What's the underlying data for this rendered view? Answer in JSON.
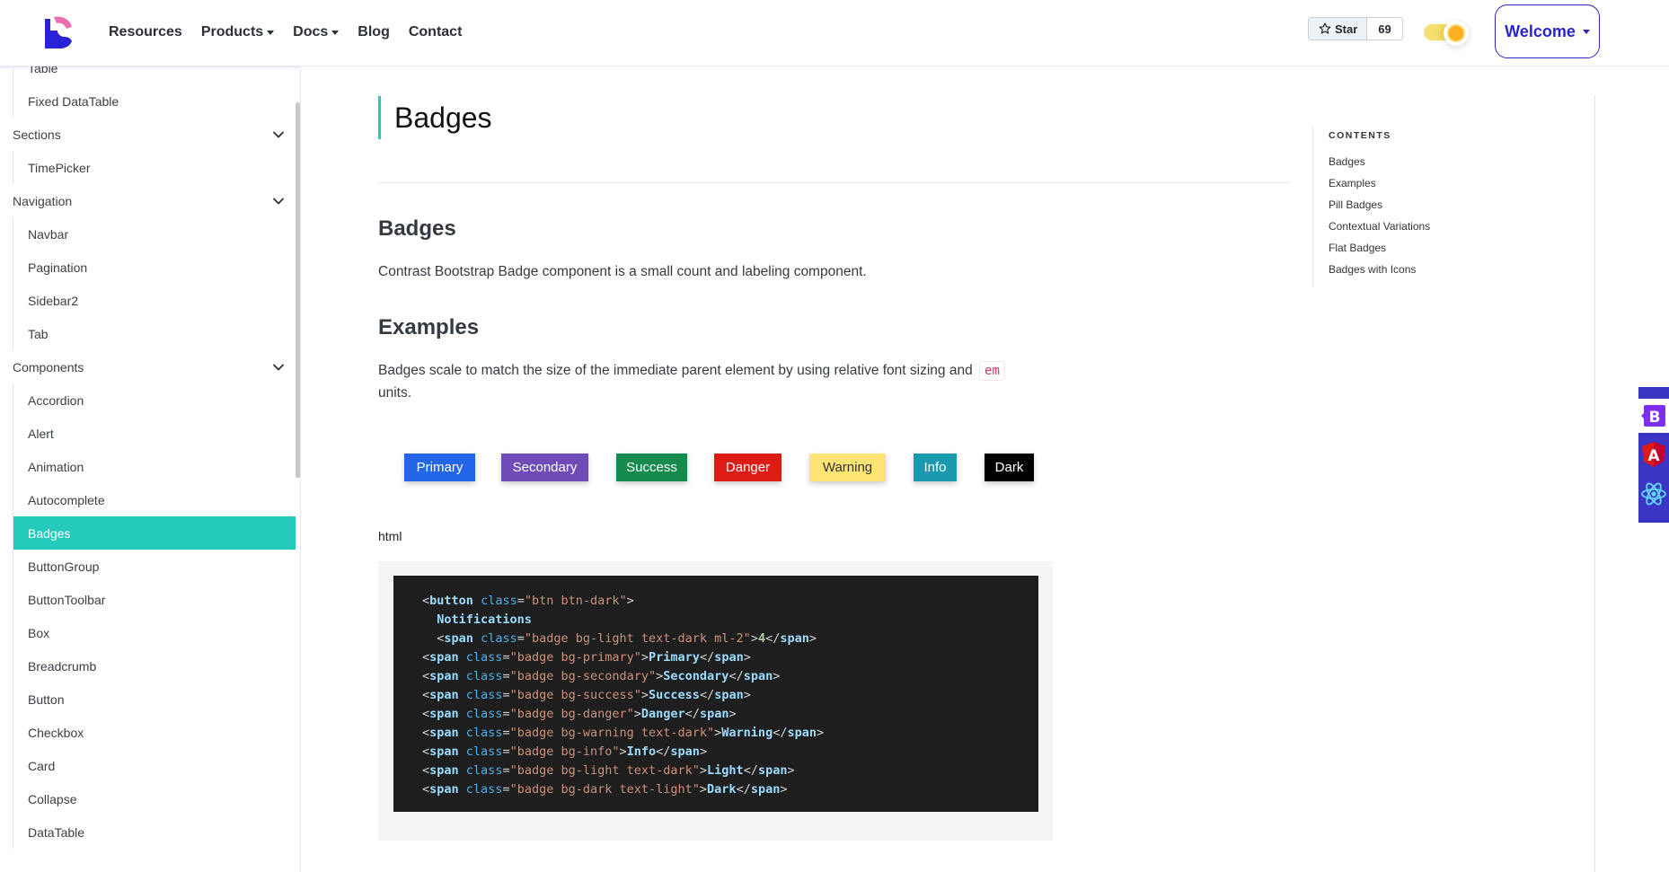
{
  "header": {
    "logo_name": "brand-logo",
    "nav": [
      {
        "label": "Resources",
        "dropdown": false
      },
      {
        "label": "Products",
        "dropdown": true
      },
      {
        "label": "Docs",
        "dropdown": true
      },
      {
        "label": "Blog",
        "dropdown": false
      },
      {
        "label": "Contact",
        "dropdown": false
      }
    ],
    "star_label": "Star",
    "star_count": "69",
    "theme": "light",
    "welcome_label": "Welcome"
  },
  "sidebar": {
    "groups": [
      {
        "section": null,
        "items": [
          "Table",
          "Fixed DataTable"
        ]
      },
      {
        "section": "Sections",
        "items": [
          "TimePicker"
        ]
      },
      {
        "section": "Navigation",
        "items": [
          "Navbar",
          "Pagination",
          "Sidebar2",
          "Tab"
        ]
      },
      {
        "section": "Components",
        "items": [
          "Accordion",
          "Alert",
          "Animation",
          "Autocomplete",
          "Badges",
          "ButtonGroup",
          "ButtonToolbar",
          "Box",
          "Breadcrumb",
          "Button",
          "Checkbox",
          "Card",
          "Collapse",
          "DataTable"
        ]
      }
    ],
    "active_item": "Badges"
  },
  "main": {
    "page_title": "Badges",
    "section1": {
      "heading": "Badges",
      "text": "Contrast Bootstrap Badge component is a small count and labeling component."
    },
    "section2": {
      "heading": "Examples",
      "text_before": "Badges scale to match the size of the immediate parent element by using relative font sizing and",
      "code": "em",
      "text_after": "units."
    },
    "badges": [
      {
        "label": "Primary",
        "bg": "#2466e8",
        "fg": "#ffffff"
      },
      {
        "label": "Secondary",
        "bg": "#6f4bb8",
        "fg": "#ffffff"
      },
      {
        "label": "Success",
        "bg": "#168a4d",
        "fg": "#ffffff"
      },
      {
        "label": "Danger",
        "bg": "#de1c16",
        "fg": "#ffffff"
      },
      {
        "label": "Warning",
        "bg": "#fde473",
        "fg": "#333333"
      },
      {
        "label": "Info",
        "bg": "#1b9aaf",
        "fg": "#ffffff"
      },
      {
        "label": "Dark",
        "bg": "#000000",
        "fg": "#ffffff"
      }
    ],
    "code_label": "html",
    "code_lines": [
      {
        "indent": "",
        "tag": "button",
        "cls": "btn btn-dark",
        "text": null,
        "close": false
      },
      {
        "indent": "  ",
        "plain": "Notifications"
      },
      {
        "indent": "  ",
        "tag": "span",
        "cls": "badge bg-light text-dark ml-2",
        "text": "4",
        "close": true,
        "numeric": true
      },
      {
        "indent": "",
        "tag": "span",
        "cls": "badge bg-primary",
        "text": "Primary",
        "close": true
      },
      {
        "indent": "",
        "tag": "span",
        "cls": "badge bg-secondary",
        "text": "Secondary",
        "close": true
      },
      {
        "indent": "",
        "tag": "span",
        "cls": "badge bg-success",
        "text": "Success",
        "close": true
      },
      {
        "indent": "",
        "tag": "span",
        "cls": "badge bg-danger",
        "text": "Danger",
        "close": true
      },
      {
        "indent": "",
        "tag": "span",
        "cls": "badge bg-warning text-dark",
        "text": "Warning",
        "close": true
      },
      {
        "indent": "",
        "tag": "span",
        "cls": "badge bg-info",
        "text": "Info",
        "close": true
      },
      {
        "indent": "",
        "tag": "span",
        "cls": "badge bg-light text-dark",
        "text": "Light",
        "close": true
      },
      {
        "indent": "",
        "tag": "span",
        "cls": "badge bg-dark text-light",
        "text": "Dark",
        "close": true
      }
    ]
  },
  "toc": {
    "title": "CONTENTS",
    "items": [
      "Badges",
      "Examples",
      "Pill Badges",
      "Contextual Variations",
      "Flat Badges",
      "Badges with Icons"
    ]
  },
  "framework_switcher": {
    "items": [
      {
        "name": "bootstrap-icon",
        "label": "B",
        "active": true
      },
      {
        "name": "angular-icon",
        "label": "A",
        "active": false
      },
      {
        "name": "react-icon",
        "label": "",
        "active": false
      }
    ]
  },
  "colors": {
    "accent": "#24cbbd",
    "brand": "#2a25c9",
    "code_bg": "#1e1e1e"
  }
}
